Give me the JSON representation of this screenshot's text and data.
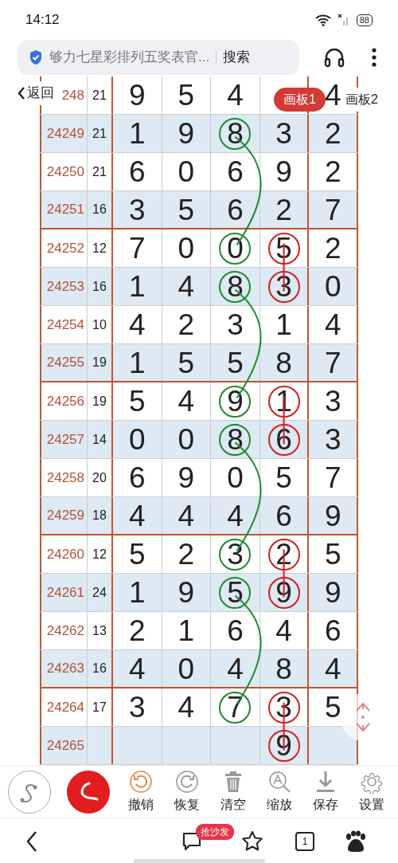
{
  "status_bar": {
    "time": "14:12",
    "battery": "88"
  },
  "address_bar": {
    "title": "够力七星彩排列五奖表官...",
    "search_button": "搜索"
  },
  "overlay": {
    "back": "返回",
    "boards": [
      {
        "label": "画板1",
        "selected": true
      },
      {
        "label": "画板2",
        "selected": false
      }
    ]
  },
  "table": {
    "rows": [
      {
        "issue": "248",
        "sum": "21",
        "cells": [
          {
            "text": "9"
          },
          {
            "text": "5"
          },
          {
            "text": "4"
          },
          {
            "text": null
          },
          {
            "text": "4"
          }
        ]
      },
      {
        "issue": "24249",
        "sum": "21",
        "cells": [
          {
            "text": "1"
          },
          {
            "text": "9"
          },
          {
            "text": "8",
            "color": "#1f8a2e"
          },
          {
            "text": "3"
          },
          {
            "text": "2"
          }
        ]
      },
      {
        "issue": "24250",
        "sum": "21",
        "cells": [
          {
            "text": "6"
          },
          {
            "text": "0"
          },
          {
            "text": "6"
          },
          {
            "text": "9"
          },
          {
            "text": "2"
          }
        ]
      },
      {
        "issue": "24251",
        "sum": "16",
        "cells": [
          {
            "text": "3"
          },
          {
            "text": "5"
          },
          {
            "text": "6"
          },
          {
            "text": "2"
          },
          {
            "text": "7"
          }
        ]
      },
      {
        "issue": "24252",
        "sum": "12",
        "cells": [
          {
            "text": "7"
          },
          {
            "text": "0"
          },
          {
            "text": "0",
            "color": "#1f8a2e"
          },
          {
            "text": "5",
            "color": "#d42020"
          },
          {
            "text": "2"
          }
        ]
      },
      {
        "issue": "24253",
        "sum": "16",
        "cells": [
          {
            "text": "1"
          },
          {
            "text": "4"
          },
          {
            "text": "8",
            "color": "#1f8a2e"
          },
          {
            "text": "3",
            "color": "#d42020"
          },
          {
            "text": "0"
          }
        ]
      },
      {
        "issue": "24254",
        "sum": "10",
        "cells": [
          {
            "text": "4"
          },
          {
            "text": "2"
          },
          {
            "text": "3"
          },
          {
            "text": "1"
          },
          {
            "text": "4"
          }
        ]
      },
      {
        "issue": "24255",
        "sum": "19",
        "cells": [
          {
            "text": "1"
          },
          {
            "text": "5"
          },
          {
            "text": "5"
          },
          {
            "text": "8"
          },
          {
            "text": "7"
          }
        ]
      },
      {
        "issue": "24256",
        "sum": "19",
        "cells": [
          {
            "text": "5"
          },
          {
            "text": "4"
          },
          {
            "text": "9",
            "color": "#1f8a2e"
          },
          {
            "text": "1",
            "color": "#d42020"
          },
          {
            "text": "3"
          }
        ]
      },
      {
        "issue": "24257",
        "sum": "14",
        "cells": [
          {
            "text": "0"
          },
          {
            "text": "0"
          },
          {
            "text": "8",
            "color": "#1f8a2e"
          },
          {
            "text": "6",
            "color": "#d42020"
          },
          {
            "text": "3"
          }
        ]
      },
      {
        "issue": "24258",
        "sum": "20",
        "cells": [
          {
            "text": "6"
          },
          {
            "text": "9"
          },
          {
            "text": "0"
          },
          {
            "text": "5"
          },
          {
            "text": "7"
          }
        ]
      },
      {
        "issue": "24259",
        "sum": "18",
        "cells": [
          {
            "text": "4"
          },
          {
            "text": "4"
          },
          {
            "text": "4"
          },
          {
            "text": "6"
          },
          {
            "text": "9"
          }
        ]
      },
      {
        "issue": "24260",
        "sum": "12",
        "cells": [
          {
            "text": "5"
          },
          {
            "text": "2"
          },
          {
            "text": "3",
            "color": "#1f8a2e"
          },
          {
            "text": "2",
            "color": "#d42020"
          },
          {
            "text": "5"
          }
        ]
      },
      {
        "issue": "24261",
        "sum": "24",
        "cells": [
          {
            "text": "1"
          },
          {
            "text": "9"
          },
          {
            "text": "5",
            "color": "#1f8a2e"
          },
          {
            "text": "9",
            "color": "#d42020"
          },
          {
            "text": "9"
          }
        ]
      },
      {
        "issue": "24262",
        "sum": "13",
        "cells": [
          {
            "text": "2"
          },
          {
            "text": "1"
          },
          {
            "text": "6"
          },
          {
            "text": "4"
          },
          {
            "text": "6"
          }
        ]
      },
      {
        "issue": "24263",
        "sum": "16",
        "cells": [
          {
            "text": "4"
          },
          {
            "text": "0"
          },
          {
            "text": "4"
          },
          {
            "text": "8"
          },
          {
            "text": "4"
          }
        ]
      },
      {
        "issue": "24264",
        "sum": "17",
        "cells": [
          {
            "text": "3"
          },
          {
            "text": "4"
          },
          {
            "text": "7",
            "color": "#1f8a2e"
          },
          {
            "text": "3",
            "color": "#d42020"
          },
          {
            "text": "5"
          }
        ]
      },
      {
        "issue": "24265",
        "sum": null,
        "cells": [
          {
            "text": null
          },
          {
            "text": null
          },
          {
            "text": null
          },
          {
            "text": "9",
            "color": "#d42020"
          },
          {
            "text": null
          }
        ]
      }
    ]
  },
  "toolbar": {
    "modes": [
      {
        "kind": "curve",
        "selected": false
      },
      {
        "kind": "freehand",
        "selected": true
      }
    ],
    "actions": [
      {
        "kind": "undo",
        "label": "撤销",
        "highlighted": true
      },
      {
        "kind": "redo",
        "label": "恢复",
        "highlighted": false
      },
      {
        "kind": "clear",
        "label": "清空",
        "highlighted": false
      },
      {
        "kind": "zoom",
        "label": "缩放",
        "highlighted": false
      },
      {
        "kind": "save",
        "label": "保存",
        "highlighted": false
      },
      {
        "kind": "settings",
        "label": "设置",
        "highlighted": false
      }
    ]
  },
  "bottom_nav": {
    "badge": "抢沙发",
    "tab_count": "1"
  }
}
